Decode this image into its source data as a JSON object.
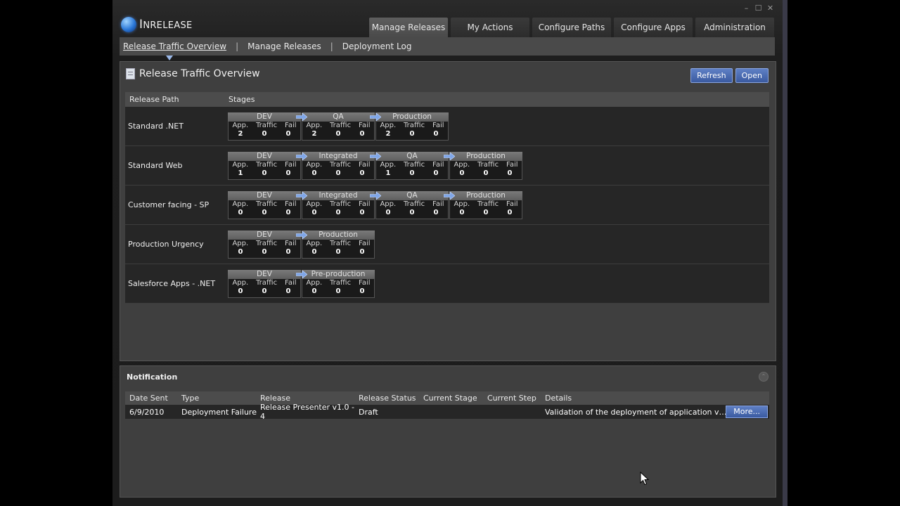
{
  "app": {
    "title": "InRelease",
    "title_first": "I",
    "title_rest": "NRELEASE"
  },
  "window_controls": {
    "minimize": "–",
    "maximize": "☐",
    "close": "✕"
  },
  "top_tabs": [
    {
      "label": "Manage Releases",
      "active": true
    },
    {
      "label": "My Actions"
    },
    {
      "label": "Configure Paths"
    },
    {
      "label": "Configure Apps"
    },
    {
      "label": "Administration"
    }
  ],
  "subnav": [
    {
      "label": "Release Traffic Overview",
      "active": true
    },
    {
      "label": "Manage Releases"
    },
    {
      "label": "Deployment Log"
    }
  ],
  "overview": {
    "title": "Release Traffic Overview",
    "refresh_label": "Refresh",
    "open_label": "Open",
    "col_path": "Release Path",
    "col_stages": "Stages",
    "stage_labels": {
      "app": "App.",
      "traffic": "Traffic",
      "fail": "Fail"
    },
    "paths": [
      {
        "name": "Standard .NET",
        "stages": [
          {
            "name": "DEV",
            "app": "2",
            "traffic": "0",
            "fail": "0"
          },
          {
            "name": "QA",
            "app": "2",
            "traffic": "0",
            "fail": "0"
          },
          {
            "name": "Production",
            "app": "2",
            "traffic": "0",
            "fail": "0"
          }
        ]
      },
      {
        "name": "Standard Web",
        "stages": [
          {
            "name": "DEV",
            "app": "1",
            "traffic": "0",
            "fail": "0"
          },
          {
            "name": "Integrated",
            "app": "0",
            "traffic": "0",
            "fail": "0"
          },
          {
            "name": "QA",
            "app": "1",
            "traffic": "0",
            "fail": "0"
          },
          {
            "name": "Production",
            "app": "0",
            "traffic": "0",
            "fail": "0"
          }
        ]
      },
      {
        "name": "Customer facing - SP",
        "stages": [
          {
            "name": "DEV",
            "app": "0",
            "traffic": "0",
            "fail": "0"
          },
          {
            "name": "Integrated",
            "app": "0",
            "traffic": "0",
            "fail": "0"
          },
          {
            "name": "QA",
            "app": "0",
            "traffic": "0",
            "fail": "0"
          },
          {
            "name": "Production",
            "app": "0",
            "traffic": "0",
            "fail": "0"
          }
        ]
      },
      {
        "name": "Production Urgency",
        "stages": [
          {
            "name": "DEV",
            "app": "0",
            "traffic": "0",
            "fail": "0"
          },
          {
            "name": "Production",
            "app": "0",
            "traffic": "0",
            "fail": "0"
          }
        ]
      },
      {
        "name": "Salesforce Apps - .NET",
        "stages": [
          {
            "name": "DEV",
            "app": "0",
            "traffic": "0",
            "fail": "0"
          },
          {
            "name": "Pre-production",
            "app": "0",
            "traffic": "0",
            "fail": "0"
          }
        ]
      }
    ]
  },
  "notification": {
    "title": "Notification",
    "columns": {
      "date": "Date Sent",
      "type": "Type",
      "release": "Release",
      "status": "Release Status",
      "stage": "Current Stage",
      "step": "Current Step",
      "details": "Details"
    },
    "rows": [
      {
        "date": "6/9/2010",
        "type": "Deployment Failure",
        "release": "Release Presenter v1.0 - 4",
        "status": "Draft",
        "stage": "",
        "step": "",
        "details": "Validation of the deployment of application version 'Rel...",
        "more_label": "More..."
      }
    ]
  },
  "colors": {
    "accent": "#4a6ab5",
    "arrow": "#7fa6e8"
  }
}
